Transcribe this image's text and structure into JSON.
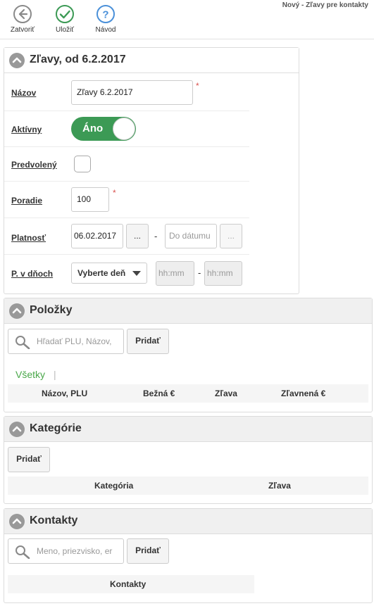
{
  "toolbar": {
    "close_label": "Zatvoriť",
    "save_label": "Uložiť",
    "help_label": "Návod",
    "title": "Nový - Zľavy pre kontakty"
  },
  "main": {
    "title": "Zľavy, od 6.2.2017",
    "name_label": "Názov",
    "name_value": "Zľavy 6.2.2017",
    "active_label": "Aktívny",
    "active_toggle": "Áno",
    "active_on": true,
    "default_label": "Predvolený",
    "default_checked": false,
    "order_label": "Poradie",
    "order_value": "100",
    "required_mark": "*",
    "validity_label": "Platnosť",
    "date_from": "06.02.2017",
    "ellipsis": "...",
    "range_dash": "-",
    "date_to_placeholder": "Do dátumu",
    "days_label": "P. v dňoch",
    "day_select": "Vyberte deň",
    "time_from_placeholder": "hh:mm",
    "time_to_placeholder": "hh:mm"
  },
  "items": {
    "title": "Položky",
    "search_placeholder": "Hľadať PLU, Názov,",
    "add_label": "Pridať",
    "tab_all": "Všetky",
    "tab_sep": "|",
    "columns": [
      "Názov, PLU",
      "Bežná €",
      "Zľava",
      "Zľavnená €"
    ]
  },
  "categories": {
    "title": "Kategórie",
    "add_label": "Pridať",
    "columns": [
      "Kategória",
      "Zľava"
    ]
  },
  "contacts": {
    "title": "Kontakty",
    "search_placeholder": "Meno, priezvisko, er",
    "add_label": "Pridať",
    "columns": [
      "Kontakty"
    ]
  },
  "colors": {
    "accent_green": "#3c9a55",
    "tab_green": "#4aa84a",
    "required_red": "#d9534f"
  }
}
